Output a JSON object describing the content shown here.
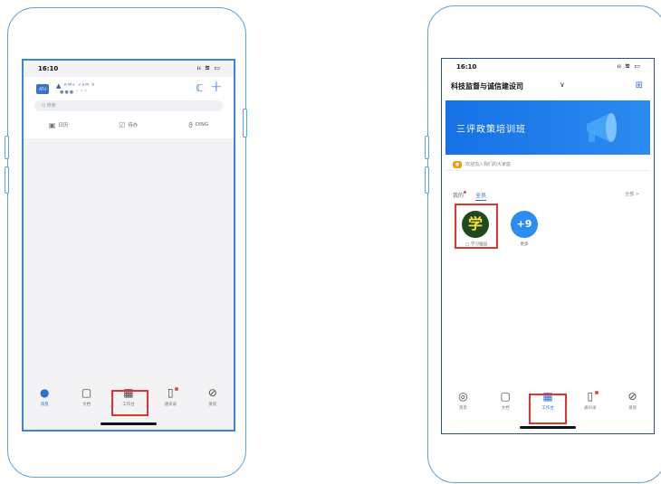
{
  "left_screen": {
    "status_time": "16:10",
    "status_icons": "ᵢᵢ ≋ ▭",
    "org_logo": "ATU",
    "org_name": "▲ ᴬᵂᵛ ᵛᵃᴹ ᵇ",
    "org_sub": "●●● ᵒ ᵒ ᵇ",
    "call_icon": "ℂ",
    "plus_icon": "+",
    "search_placeholder": "Q 搜索",
    "quick": [
      {
        "icon": "▣",
        "label": "日历"
      },
      {
        "icon": "☑",
        "label": "待办"
      },
      {
        "icon": "ϑ",
        "label": "DING"
      }
    ],
    "tabs": [
      {
        "icon": "●",
        "label": "消息"
      },
      {
        "icon": "▢",
        "label": "文档"
      },
      {
        "icon": "▦",
        "label": "工作台"
      },
      {
        "icon": "▯",
        "label": "通讯录"
      },
      {
        "icon": "⊘",
        "label": "发现"
      }
    ]
  },
  "right_screen": {
    "status_time": "16:10",
    "status_icons": "ᵢᵢ ≋ ▭",
    "org_title": "科技监督与诚信建设司",
    "chevron": "∨",
    "scan_icon": "⊞",
    "banner_text": "三评政策培训班",
    "notice_text": "欢迎加入我们的大家庭",
    "app_tabs": [
      "我的",
      "全员"
    ],
    "all_link": "全部 >",
    "app1_glyph": "学",
    "app1_label": "□ 学习强国",
    "app2_glyph": "+9",
    "app2_label": "更多",
    "tabs": [
      {
        "icon": "◎",
        "label": "消息"
      },
      {
        "icon": "▢",
        "label": "文档"
      },
      {
        "icon": "▦",
        "label": "工作台"
      },
      {
        "icon": "▯",
        "label": "通讯录"
      },
      {
        "icon": "⊘",
        "label": "发现"
      }
    ]
  },
  "colors": {
    "accent": "#2d6fd6",
    "highlight": "#e0342e",
    "frame": "#5aa3dd",
    "banner": "#1671e6"
  }
}
